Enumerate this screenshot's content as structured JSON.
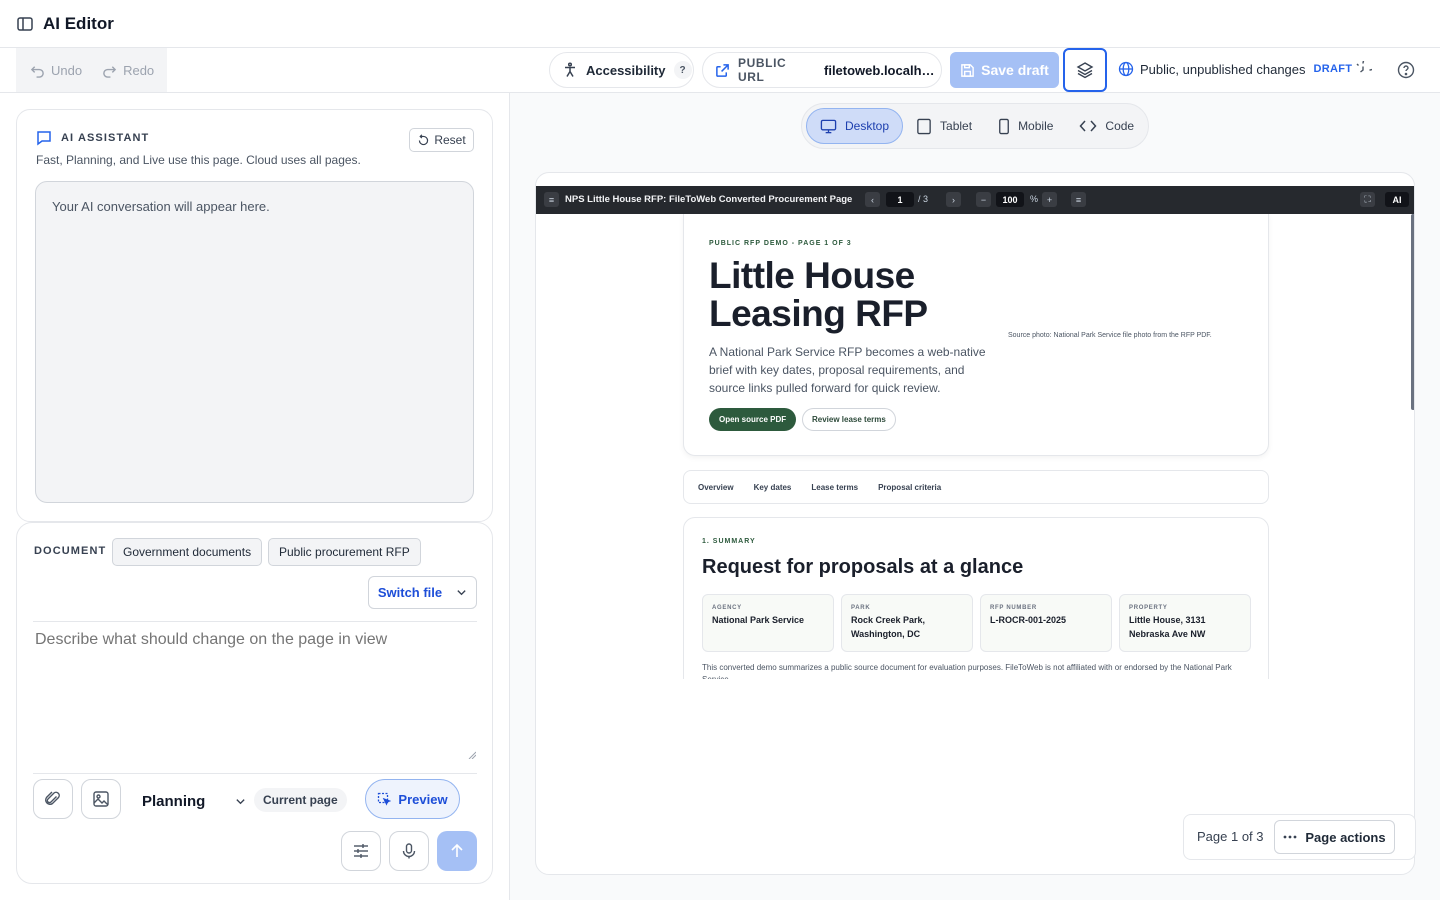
{
  "app": {
    "title": "AI Editor"
  },
  "toolbar": {
    "undo_label": "Undo",
    "redo_label": "Redo",
    "accessibility_label": "Accessibility",
    "accessibility_help": "?",
    "public_url_label": "PUBLIC URL",
    "public_url_value": "filetoweb.localhos...",
    "save_label": "Save draft",
    "status_text": "Public, unpublished changes",
    "status_badge": "DRAFT"
  },
  "assistant": {
    "heading": "AI ASSISTANT",
    "reset_label": "Reset",
    "subtitle": "Fast, Planning, and Live use this page. Cloud uses all pages.",
    "empty_message": "Your AI conversation will appear here."
  },
  "document": {
    "label": "DOCUMENT",
    "tags": [
      "Government documents",
      "Public procurement RFP"
    ],
    "switch_label": "Switch file",
    "prompt_placeholder": "Describe what should change on the page in view",
    "mode": "Planning",
    "scope": "Current page",
    "preview_label": "Preview"
  },
  "preview": {
    "tabs": [
      {
        "label": "Desktop",
        "icon": "desktop-icon",
        "active": true
      },
      {
        "label": "Tablet",
        "icon": "tablet-icon",
        "active": false
      },
      {
        "label": "Mobile",
        "icon": "mobile-icon",
        "active": false
      },
      {
        "label": "Code",
        "icon": "code-icon",
        "active": false
      }
    ],
    "viewer": {
      "title": "NPS Little House RFP: FileToWeb Converted Procurement Page",
      "page_input": "1",
      "page_total": "/ 3",
      "zoom": "100",
      "zoom_unit": "%",
      "ai_label": "AI"
    },
    "page_counter": "Page 1 of 3",
    "page_actions_label": "Page actions"
  },
  "rendered_doc": {
    "eyebrow": "PUBLIC RFP DEMO - PAGE 1 OF 3",
    "title": "Little House Leasing RFP",
    "description": "A National Park Service RFP becomes a web-native brief with key dates, proposal requirements, and source links pulled forward for quick review.",
    "primary_cta": "Open source PDF",
    "secondary_cta": "Review lease terms",
    "photo_caption": "Source photo: National Park Service file photo from the RFP PDF.",
    "nav": [
      "Overview",
      "Key dates",
      "Lease terms",
      "Proposal criteria"
    ],
    "summary_eyebrow": "1. SUMMARY",
    "summary_title": "Request for proposals at a glance",
    "facts": [
      {
        "label": "AGENCY",
        "value": "National Park Service"
      },
      {
        "label": "PARK",
        "value": "Rock Creek Park, Washington, DC"
      },
      {
        "label": "RFP NUMBER",
        "value": "L-ROCR-001-2025"
      },
      {
        "label": "PROPERTY",
        "value": "Little House, 3131 Nebraska Ave NW"
      }
    ],
    "disclaimer": "This converted demo summarizes a public source document for evaluation purposes. FileToWeb is not affiliated with or endorsed by the National Park Service."
  },
  "colors": {
    "accent": "#2563eb",
    "accent_disabled": "#a5c0f5",
    "doc_green": "#2d5a3d",
    "viewer_bar": "#26292e"
  }
}
